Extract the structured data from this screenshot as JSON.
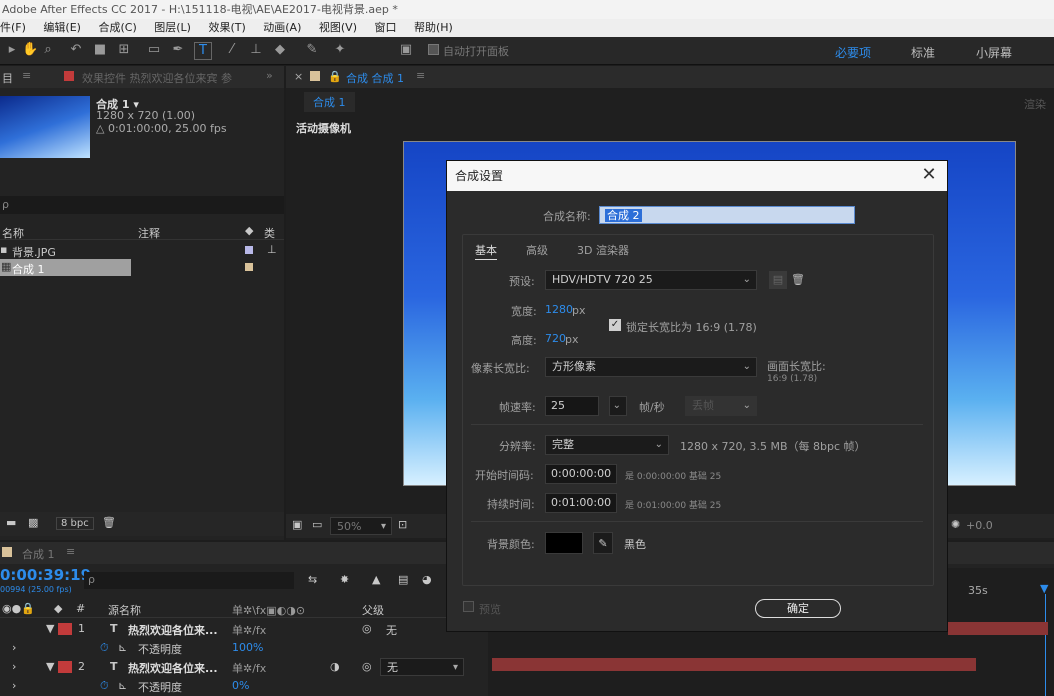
{
  "app": {
    "title": "Adobe After Effects CC 2017 - H:\\151118-电视\\AE\\AE2017-电视背景.aep *"
  },
  "menu": [
    "件(F)",
    "编辑(E)",
    "合成(C)",
    "图层(L)",
    "效果(T)",
    "动画(A)",
    "视图(V)",
    "窗口",
    "帮助(H)"
  ],
  "toolbar": {
    "auto_open_label": "自动打开面板",
    "workspaces": [
      "必要项",
      "标准",
      "小屏幕"
    ]
  },
  "project_panel": {
    "tab_label": "目",
    "effects_tab": "效果控件 热烈欢迎各位来宾 参",
    "comp_name": "合成 1 ▾",
    "comp_size": "1280 x 720 (1.00)",
    "comp_duration": "△ 0:01:00:00, 25.00 fps",
    "search_placeholder": "ρ",
    "columns": [
      "名称",
      "注释",
      "类"
    ],
    "items": [
      "背景.JPG",
      "合成 1"
    ],
    "bpc": "8 bpc"
  },
  "comp_viewer": {
    "tab_label": "合成 合成 1",
    "breadcrumb": "合成 1",
    "camera_label": "活动摄像机",
    "zoom": "50%",
    "exposure": "+0.0",
    "render_label": "渲染"
  },
  "timeline": {
    "tab_label": "合成 1",
    "timecode": "0:00:39:19",
    "fps_note": "00994 (25.00 fps)",
    "columns": {
      "source": "源名称",
      "parent": "父级"
    },
    "ruler_mark": "35s",
    "layers": [
      {
        "num": "1",
        "name": "热烈欢迎各位来...",
        "parent": "无"
      },
      {
        "num": "2",
        "name": "热烈欢迎各位来...",
        "parent": "无"
      }
    ],
    "opacity_label": "不透明度",
    "opacity_values": [
      "100%",
      "0%"
    ]
  },
  "dialog": {
    "title": "合成设置",
    "name_label": "合成名称:",
    "name_value": "合成 2",
    "tabs": [
      "基本",
      "高级",
      "3D 渲染器"
    ],
    "preset_label": "预设:",
    "preset_value": "HDV/HDTV 720 25",
    "width_label": "宽度:",
    "width_value": "1280",
    "height_label": "高度:",
    "height_value": "720",
    "unit_px": "px",
    "lock_label": "锁定长宽比为 16:9 (1.78)",
    "pixel_aspect_label": "像素长宽比:",
    "pixel_aspect_value": "方形像素",
    "frame_aspect_label": "画面长宽比:",
    "frame_aspect_value": "16:9 (1.78)",
    "fps_label": "帧速率:",
    "fps_value": "25",
    "fps_unit": "帧/秒",
    "drop_frame": "丢帧",
    "resolution_label": "分辨率:",
    "resolution_value": "完整",
    "resolution_info": "1280 x 720, 3.5 MB（每 8bpc 帧）",
    "start_tc_label": "开始时间码:",
    "start_tc_value": "0:00:00:00",
    "start_tc_info": "是 0:00:00:00  基础 25",
    "duration_label": "持续时间:",
    "duration_value": "0:01:00:00",
    "duration_info": "是 0:01:00:00  基础 25",
    "bg_color_label": "背景颜色:",
    "bg_color_name": "黑色",
    "bg_color_hex": "#000000",
    "preview_label": "预览",
    "ok_label": "确定"
  },
  "colors": {
    "accent": "#2d8ceb",
    "layer_label": "#c23b3b",
    "track_bar": "#8a3535"
  }
}
